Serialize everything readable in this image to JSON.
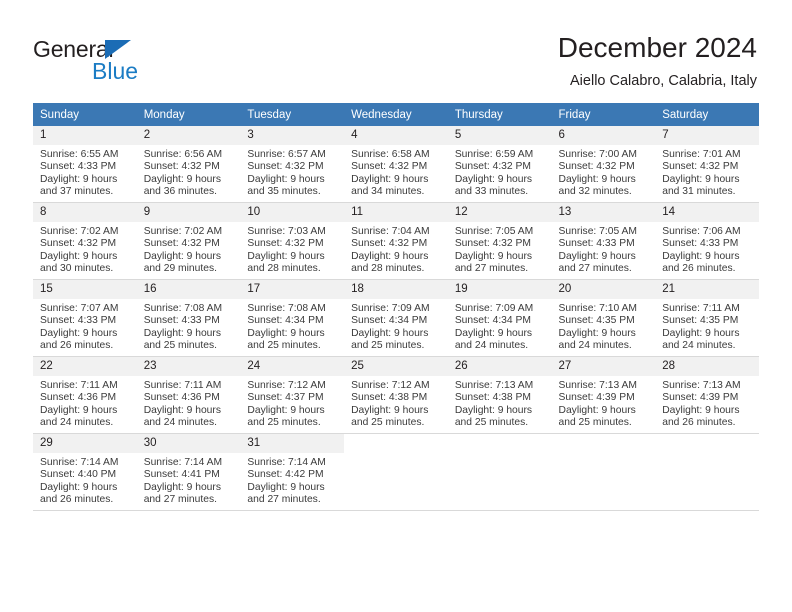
{
  "brand": {
    "name_part1": "General",
    "name_part2": "Blue",
    "triangle_color": "#1b6cb5",
    "blue_color": "#1b7cc4"
  },
  "header": {
    "title": "December 2024",
    "subtitle": "Aiello Calabro, Calabria, Italy",
    "header_bg_color": "#3b78b4",
    "daynum_bg_color": "#f1f1f1"
  },
  "weekday_headers": [
    "Sunday",
    "Monday",
    "Tuesday",
    "Wednesday",
    "Thursday",
    "Friday",
    "Saturday"
  ],
  "weeks": [
    [
      {
        "day": "1",
        "sunrise": "Sunrise: 6:55 AM",
        "sunset": "Sunset: 4:33 PM",
        "daylight1": "Daylight: 9 hours",
        "daylight2": "and 37 minutes."
      },
      {
        "day": "2",
        "sunrise": "Sunrise: 6:56 AM",
        "sunset": "Sunset: 4:32 PM",
        "daylight1": "Daylight: 9 hours",
        "daylight2": "and 36 minutes."
      },
      {
        "day": "3",
        "sunrise": "Sunrise: 6:57 AM",
        "sunset": "Sunset: 4:32 PM",
        "daylight1": "Daylight: 9 hours",
        "daylight2": "and 35 minutes."
      },
      {
        "day": "4",
        "sunrise": "Sunrise: 6:58 AM",
        "sunset": "Sunset: 4:32 PM",
        "daylight1": "Daylight: 9 hours",
        "daylight2": "and 34 minutes."
      },
      {
        "day": "5",
        "sunrise": "Sunrise: 6:59 AM",
        "sunset": "Sunset: 4:32 PM",
        "daylight1": "Daylight: 9 hours",
        "daylight2": "and 33 minutes."
      },
      {
        "day": "6",
        "sunrise": "Sunrise: 7:00 AM",
        "sunset": "Sunset: 4:32 PM",
        "daylight1": "Daylight: 9 hours",
        "daylight2": "and 32 minutes."
      },
      {
        "day": "7",
        "sunrise": "Sunrise: 7:01 AM",
        "sunset": "Sunset: 4:32 PM",
        "daylight1": "Daylight: 9 hours",
        "daylight2": "and 31 minutes."
      }
    ],
    [
      {
        "day": "8",
        "sunrise": "Sunrise: 7:02 AM",
        "sunset": "Sunset: 4:32 PM",
        "daylight1": "Daylight: 9 hours",
        "daylight2": "and 30 minutes."
      },
      {
        "day": "9",
        "sunrise": "Sunrise: 7:02 AM",
        "sunset": "Sunset: 4:32 PM",
        "daylight1": "Daylight: 9 hours",
        "daylight2": "and 29 minutes."
      },
      {
        "day": "10",
        "sunrise": "Sunrise: 7:03 AM",
        "sunset": "Sunset: 4:32 PM",
        "daylight1": "Daylight: 9 hours",
        "daylight2": "and 28 minutes."
      },
      {
        "day": "11",
        "sunrise": "Sunrise: 7:04 AM",
        "sunset": "Sunset: 4:32 PM",
        "daylight1": "Daylight: 9 hours",
        "daylight2": "and 28 minutes."
      },
      {
        "day": "12",
        "sunrise": "Sunrise: 7:05 AM",
        "sunset": "Sunset: 4:32 PM",
        "daylight1": "Daylight: 9 hours",
        "daylight2": "and 27 minutes."
      },
      {
        "day": "13",
        "sunrise": "Sunrise: 7:05 AM",
        "sunset": "Sunset: 4:33 PM",
        "daylight1": "Daylight: 9 hours",
        "daylight2": "and 27 minutes."
      },
      {
        "day": "14",
        "sunrise": "Sunrise: 7:06 AM",
        "sunset": "Sunset: 4:33 PM",
        "daylight1": "Daylight: 9 hours",
        "daylight2": "and 26 minutes."
      }
    ],
    [
      {
        "day": "15",
        "sunrise": "Sunrise: 7:07 AM",
        "sunset": "Sunset: 4:33 PM",
        "daylight1": "Daylight: 9 hours",
        "daylight2": "and 26 minutes."
      },
      {
        "day": "16",
        "sunrise": "Sunrise: 7:08 AM",
        "sunset": "Sunset: 4:33 PM",
        "daylight1": "Daylight: 9 hours",
        "daylight2": "and 25 minutes."
      },
      {
        "day": "17",
        "sunrise": "Sunrise: 7:08 AM",
        "sunset": "Sunset: 4:34 PM",
        "daylight1": "Daylight: 9 hours",
        "daylight2": "and 25 minutes."
      },
      {
        "day": "18",
        "sunrise": "Sunrise: 7:09 AM",
        "sunset": "Sunset: 4:34 PM",
        "daylight1": "Daylight: 9 hours",
        "daylight2": "and 25 minutes."
      },
      {
        "day": "19",
        "sunrise": "Sunrise: 7:09 AM",
        "sunset": "Sunset: 4:34 PM",
        "daylight1": "Daylight: 9 hours",
        "daylight2": "and 24 minutes."
      },
      {
        "day": "20",
        "sunrise": "Sunrise: 7:10 AM",
        "sunset": "Sunset: 4:35 PM",
        "daylight1": "Daylight: 9 hours",
        "daylight2": "and 24 minutes."
      },
      {
        "day": "21",
        "sunrise": "Sunrise: 7:11 AM",
        "sunset": "Sunset: 4:35 PM",
        "daylight1": "Daylight: 9 hours",
        "daylight2": "and 24 minutes."
      }
    ],
    [
      {
        "day": "22",
        "sunrise": "Sunrise: 7:11 AM",
        "sunset": "Sunset: 4:36 PM",
        "daylight1": "Daylight: 9 hours",
        "daylight2": "and 24 minutes."
      },
      {
        "day": "23",
        "sunrise": "Sunrise: 7:11 AM",
        "sunset": "Sunset: 4:36 PM",
        "daylight1": "Daylight: 9 hours",
        "daylight2": "and 24 minutes."
      },
      {
        "day": "24",
        "sunrise": "Sunrise: 7:12 AM",
        "sunset": "Sunset: 4:37 PM",
        "daylight1": "Daylight: 9 hours",
        "daylight2": "and 25 minutes."
      },
      {
        "day": "25",
        "sunrise": "Sunrise: 7:12 AM",
        "sunset": "Sunset: 4:38 PM",
        "daylight1": "Daylight: 9 hours",
        "daylight2": "and 25 minutes."
      },
      {
        "day": "26",
        "sunrise": "Sunrise: 7:13 AM",
        "sunset": "Sunset: 4:38 PM",
        "daylight1": "Daylight: 9 hours",
        "daylight2": "and 25 minutes."
      },
      {
        "day": "27",
        "sunrise": "Sunrise: 7:13 AM",
        "sunset": "Sunset: 4:39 PM",
        "daylight1": "Daylight: 9 hours",
        "daylight2": "and 25 minutes."
      },
      {
        "day": "28",
        "sunrise": "Sunrise: 7:13 AM",
        "sunset": "Sunset: 4:39 PM",
        "daylight1": "Daylight: 9 hours",
        "daylight2": "and 26 minutes."
      }
    ],
    [
      {
        "day": "29",
        "sunrise": "Sunrise: 7:14 AM",
        "sunset": "Sunset: 4:40 PM",
        "daylight1": "Daylight: 9 hours",
        "daylight2": "and 26 minutes."
      },
      {
        "day": "30",
        "sunrise": "Sunrise: 7:14 AM",
        "sunset": "Sunset: 4:41 PM",
        "daylight1": "Daylight: 9 hours",
        "daylight2": "and 27 minutes."
      },
      {
        "day": "31",
        "sunrise": "Sunrise: 7:14 AM",
        "sunset": "Sunset: 4:42 PM",
        "daylight1": "Daylight: 9 hours",
        "daylight2": "and 27 minutes."
      },
      {
        "day": "",
        "sunrise": "",
        "sunset": "",
        "daylight1": "",
        "daylight2": ""
      },
      {
        "day": "",
        "sunrise": "",
        "sunset": "",
        "daylight1": "",
        "daylight2": ""
      },
      {
        "day": "",
        "sunrise": "",
        "sunset": "",
        "daylight1": "",
        "daylight2": ""
      },
      {
        "day": "",
        "sunrise": "",
        "sunset": "",
        "daylight1": "",
        "daylight2": ""
      }
    ]
  ]
}
